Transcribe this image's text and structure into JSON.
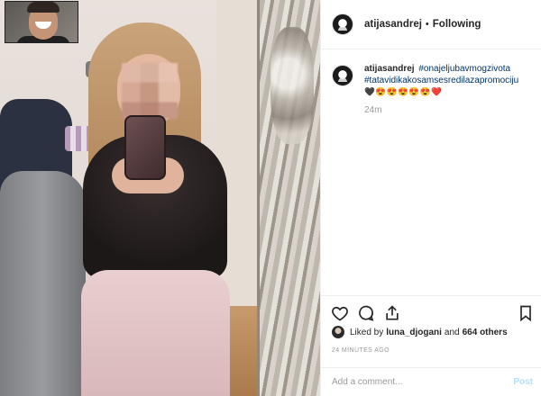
{
  "post": {
    "username": "atijasandrej",
    "separator": "•",
    "follow_status": "Following"
  },
  "caption": {
    "username": "atijasandrej",
    "hashtags": [
      "#onajeljubavmogzivota",
      "#tatavidikakosamsesredilazapromociju"
    ],
    "emojis": "🖤😍😍😍😍😍❤️",
    "time": "24m"
  },
  "engagement": {
    "liked_by_prefix": "Liked by",
    "liked_by_user": "luna_djogani",
    "and_text": "and",
    "others": "664 others",
    "timestamp": "24 MINUTES AGO"
  },
  "comment_box": {
    "placeholder": "Add a comment...",
    "post_label": "Post"
  },
  "icons": [
    "heart-icon",
    "comment-icon",
    "share-icon",
    "bookmark-icon"
  ],
  "colors": {
    "hashtag": "#003569",
    "muted": "#999999",
    "post_button": "#b2dffc"
  }
}
